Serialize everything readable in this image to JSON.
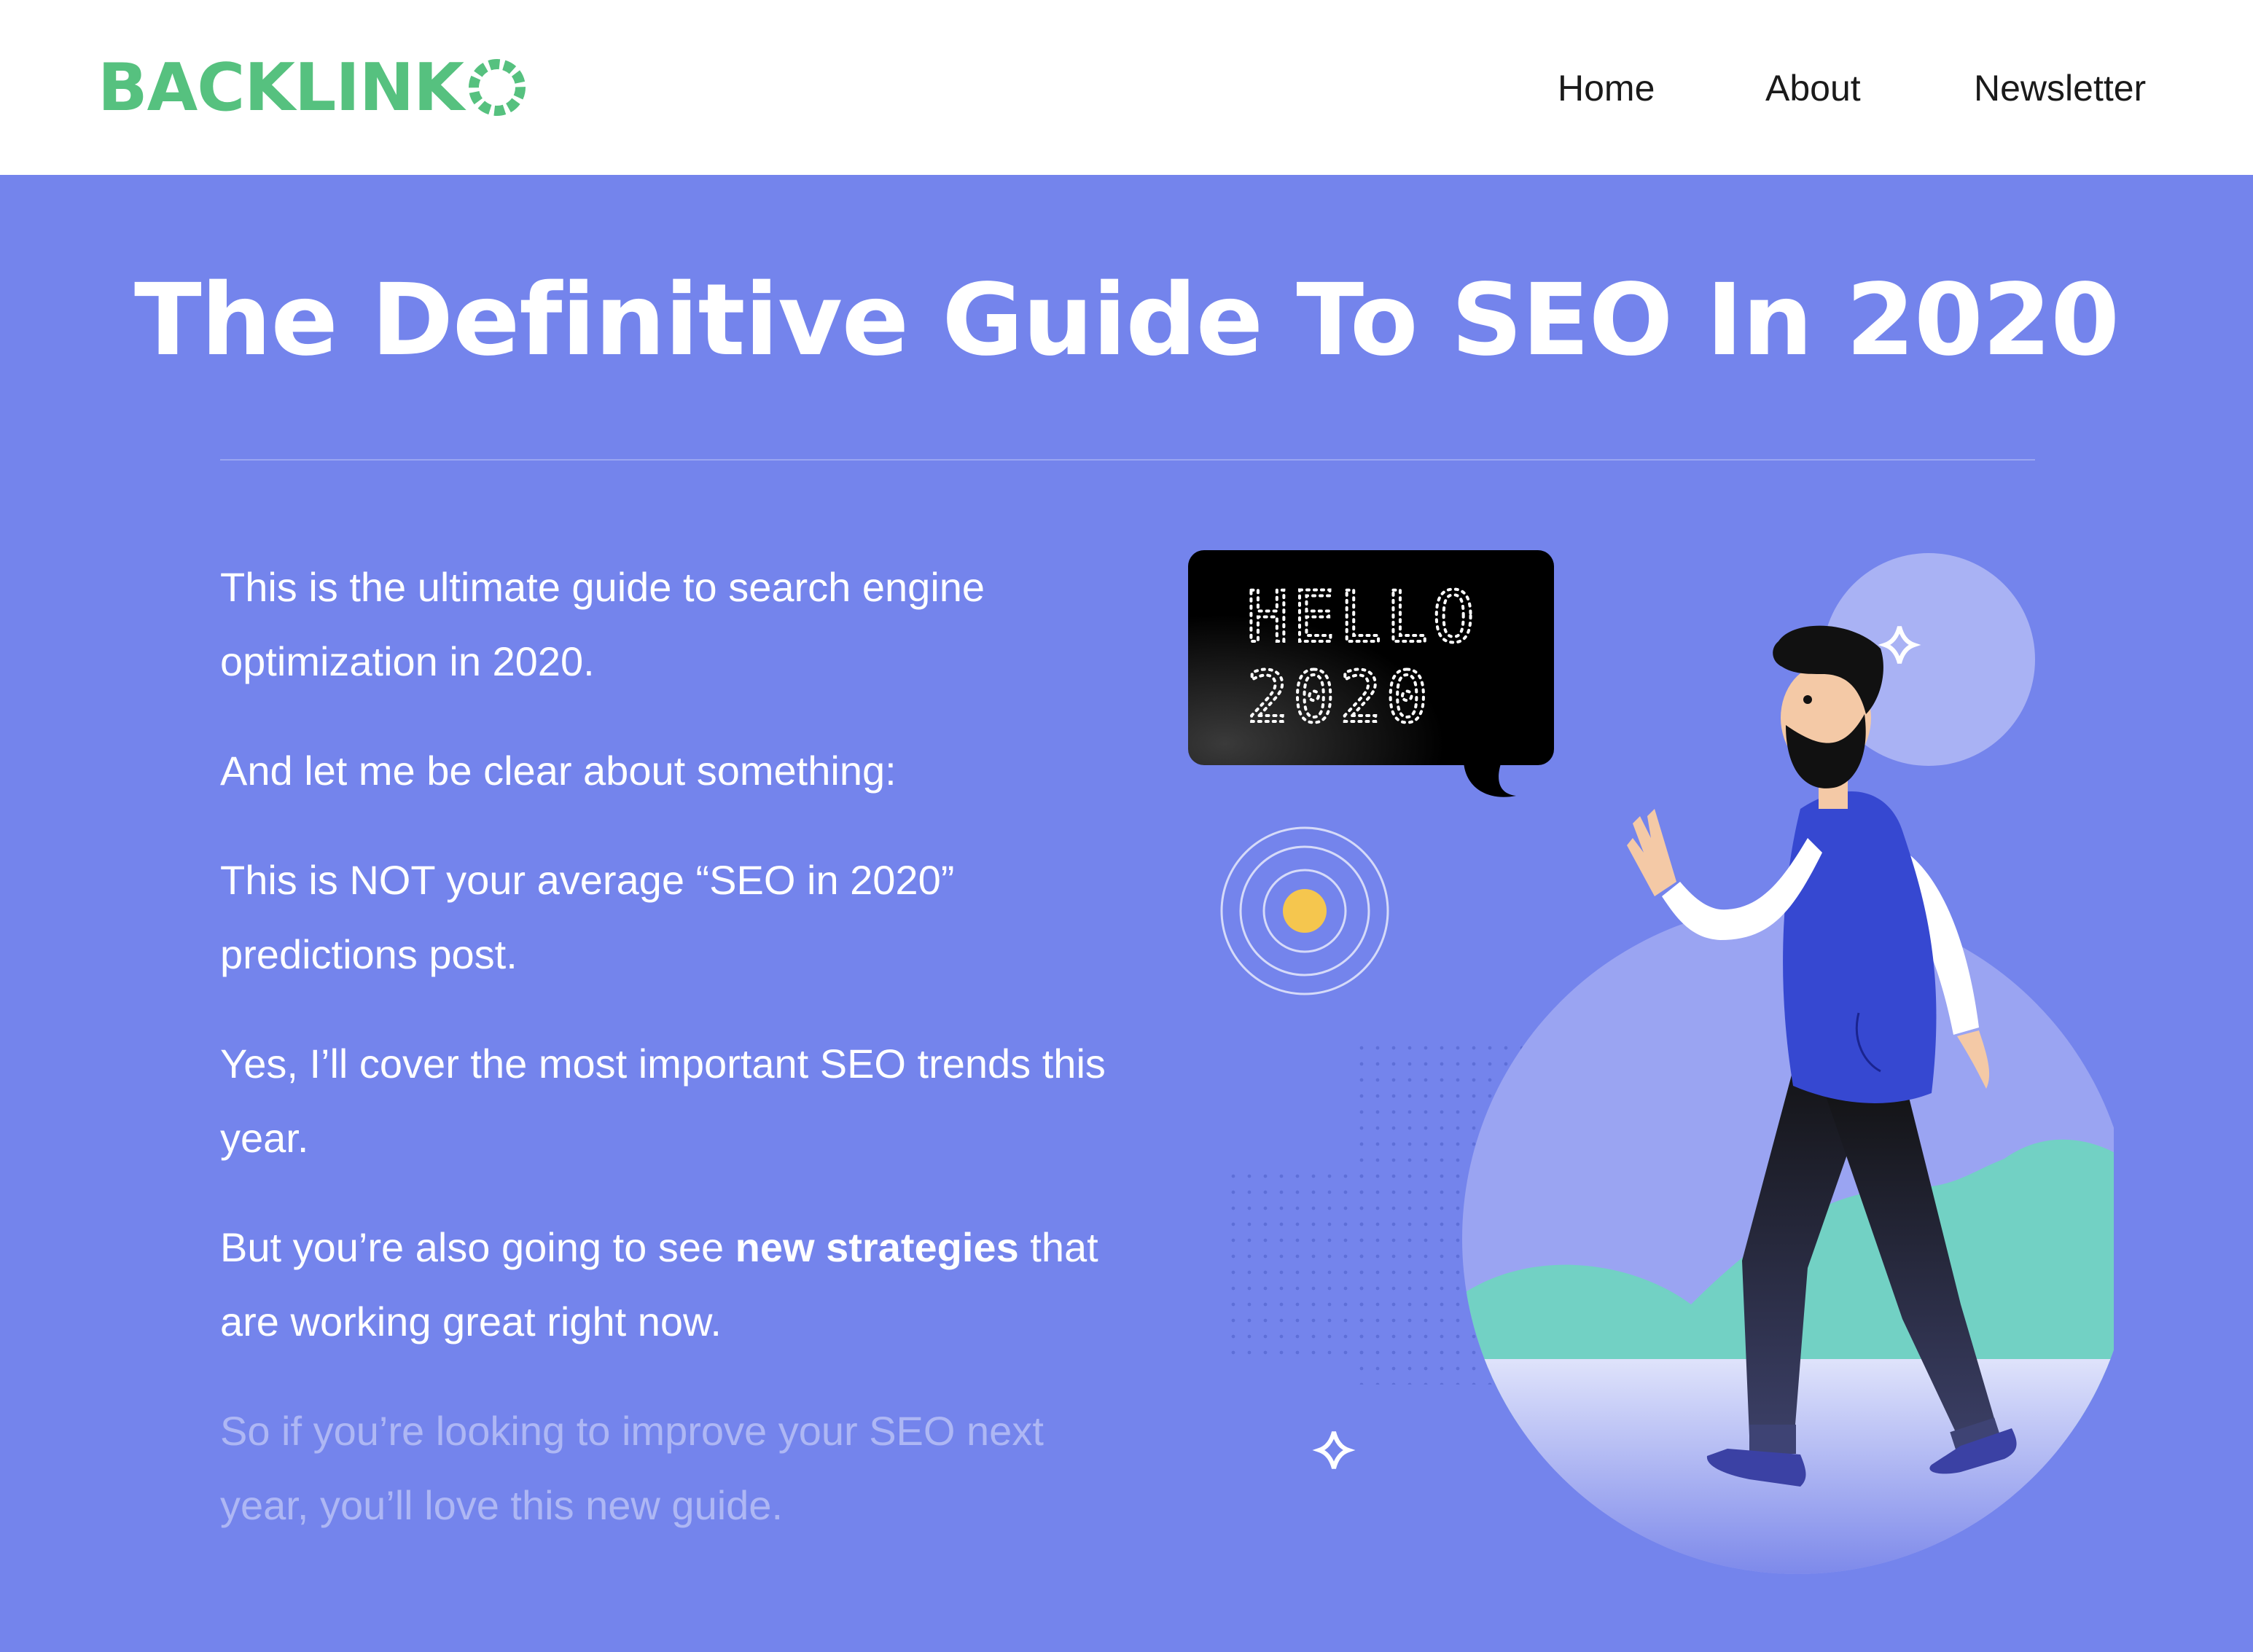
{
  "header": {
    "logo_text": "BACKLINK",
    "logo_brand_color": "#56c17f",
    "nav": [
      {
        "label": "Home"
      },
      {
        "label": "About"
      },
      {
        "label": "Newsletter"
      }
    ]
  },
  "hero": {
    "title": "The Definitive Guide To SEO In 2020",
    "background_color": "#7484ec",
    "paragraphs": {
      "p1": "This is the ultimate guide to search engine optimization in 2020.",
      "p2": "And let me be clear about something:",
      "p3": "This is NOT your average “SEO in 2020” predictions post.",
      "p4": "Yes, I’ll cover the most important SEO trends this year.",
      "p5_before": "But you’re also going to see ",
      "p5_bold": "new strategies",
      "p5_after": " that are working great right now.",
      "p6": "So if you’re looking to improve your SEO next year, you’ll love this new guide."
    },
    "illustration": {
      "speech_bubble_line1": "HELLO",
      "speech_bubble_line2": "2020",
      "icons": [
        "sparkle-icon",
        "target-circle-icon",
        "waving-man-illustration"
      ]
    }
  }
}
